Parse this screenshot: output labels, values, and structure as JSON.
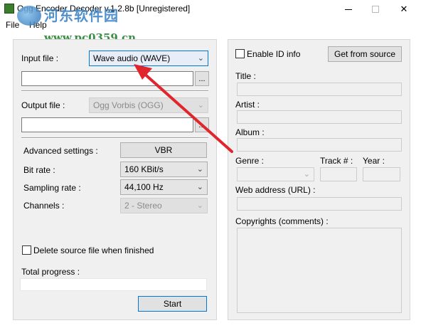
{
  "window": {
    "title": "Ogg Encoder Decoder v.1.2.8b [Unregistered]",
    "minimize_glyph": "—",
    "maximize_glyph": "",
    "close_glyph": "✕"
  },
  "watermark": {
    "line1": "河东软件园",
    "line2": "www.pc0359.cn"
  },
  "menu": {
    "file": "File",
    "help": "Help"
  },
  "left": {
    "input_file_label": "Input file :",
    "input_format": "Wave audio (WAVE)",
    "input_path": "",
    "browse_label": "...",
    "output_file_label": "Output file :",
    "output_format": "Ogg Vorbis (OGG)",
    "output_path": "",
    "advanced_label": "Advanced settings :",
    "vbr_label": "VBR",
    "bitrate_label": "Bit rate :",
    "bitrate_value": "160 KBit/s",
    "sampling_label": "Sampling rate :",
    "sampling_value": "44,100 Hz",
    "channels_label": "Channels :",
    "channels_value": "2 - Stereo",
    "delete_source_label": "Delete source file when finished",
    "delete_source_checked": false,
    "total_progress_label": "Total progress :",
    "progress": 0,
    "start_label": "Start"
  },
  "right": {
    "enable_id_label": "Enable ID info",
    "enable_id_checked": false,
    "get_from_source_label": "Get from source",
    "title_label": "Title :",
    "artist_label": "Artist :",
    "album_label": "Album :",
    "genre_label": "Genre :",
    "track_label": "Track # :",
    "year_label": "Year :",
    "web_label": "Web address (URL) :",
    "copyrights_label": "Copyrights (comments) :"
  },
  "colors": {
    "accent": "#0078d7",
    "annotation_arrow": "#e0262c"
  }
}
